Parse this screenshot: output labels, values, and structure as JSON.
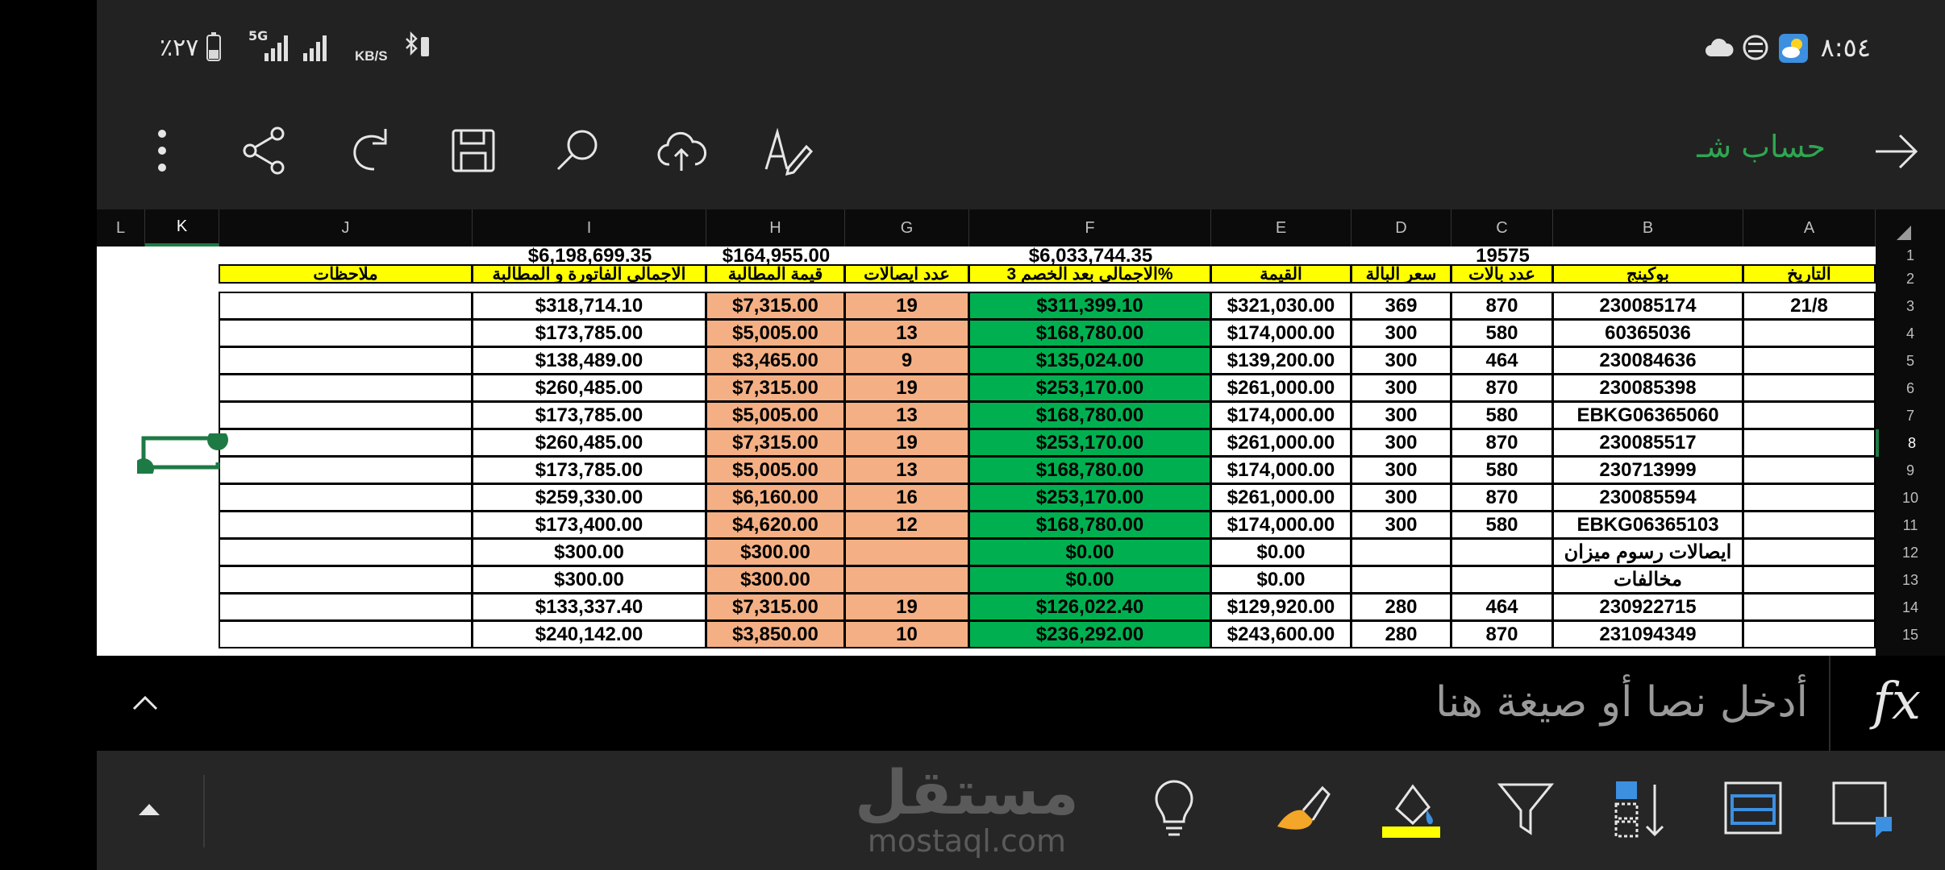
{
  "status_bar": {
    "time": "٨:٥٤",
    "battery": "٪٢٧",
    "network": "5G",
    "speed_unit": "KB/S"
  },
  "toolbar": {
    "sheet_name": "حساب شـ"
  },
  "columns": [
    "A",
    "B",
    "C",
    "D",
    "E",
    "F",
    "G",
    "H",
    "I",
    "J",
    "K",
    "L"
  ],
  "selected_column": "K",
  "rows": [
    "1",
    "2",
    "3",
    "4",
    "5",
    "6",
    "7",
    "8",
    "9",
    "10",
    "11",
    "12",
    "13",
    "14",
    "15"
  ],
  "selected_row": "8",
  "sheet": {
    "row1": {
      "C": "19575",
      "F": "$6,033,744.35",
      "H": "$164,955.00",
      "I": "$6,198,699.35"
    },
    "headers": {
      "A": "التاريخ",
      "B": "بوكينج",
      "C": "عدد بالات",
      "D": "سعر  البالة",
      "E": "القيمة",
      "F": "الاجمالى بعد الخصم 3%",
      "G": "عدد ايصالات",
      "H": "قيمة المطالبة",
      "I": "الاجمالى الفاتورة و المطالبة",
      "J": "ملاحظات"
    },
    "data": [
      {
        "A": "21/8",
        "B": "230085174",
        "C": "870",
        "D": "369",
        "E": "$321,030.00",
        "F": "$311,399.10",
        "G": "19",
        "H": "$7,315.00",
        "I": "$318,714.10",
        "J": ""
      },
      {
        "A": "",
        "B": "60365036",
        "C": "580",
        "D": "300",
        "E": "$174,000.00",
        "F": "$168,780.00",
        "G": "13",
        "H": "$5,005.00",
        "I": "$173,785.00",
        "J": ""
      },
      {
        "A": "",
        "B": "230084636",
        "C": "464",
        "D": "300",
        "E": "$139,200.00",
        "F": "$135,024.00",
        "G": "9",
        "H": "$3,465.00",
        "I": "$138,489.00",
        "J": ""
      },
      {
        "A": "",
        "B": "230085398",
        "C": "870",
        "D": "300",
        "E": "$261,000.00",
        "F": "$253,170.00",
        "G": "19",
        "H": "$7,315.00",
        "I": "$260,485.00",
        "J": ""
      },
      {
        "A": "",
        "B": "EBKG06365060",
        "C": "580",
        "D": "300",
        "E": "$174,000.00",
        "F": "$168,780.00",
        "G": "13",
        "H": "$5,005.00",
        "I": "$173,785.00",
        "J": ""
      },
      {
        "A": "",
        "B": "230085517",
        "C": "870",
        "D": "300",
        "E": "$261,000.00",
        "F": "$253,170.00",
        "G": "19",
        "H": "$7,315.00",
        "I": "$260,485.00",
        "J": ""
      },
      {
        "A": "",
        "B": "230713999",
        "C": "580",
        "D": "300",
        "E": "$174,000.00",
        "F": "$168,780.00",
        "G": "13",
        "H": "$5,005.00",
        "I": "$173,785.00",
        "J": ""
      },
      {
        "A": "",
        "B": "230085594",
        "C": "870",
        "D": "300",
        "E": "$261,000.00",
        "F": "$253,170.00",
        "G": "16",
        "H": "$6,160.00",
        "I": "$259,330.00",
        "J": ""
      },
      {
        "A": "",
        "B": "EBKG06365103",
        "C": "580",
        "D": "300",
        "E": "$174,000.00",
        "F": "$168,780.00",
        "G": "12",
        "H": "$4,620.00",
        "I": "$173,400.00",
        "J": ""
      },
      {
        "A": "",
        "B": "ايصالات رسوم ميزان",
        "C": "",
        "D": "",
        "E": "$0.00",
        "F": "$0.00",
        "G": "",
        "H": "$300.00",
        "I": "$300.00",
        "J": ""
      },
      {
        "A": "",
        "B": "مخالفات",
        "C": "",
        "D": "",
        "E": "$0.00",
        "F": "$0.00",
        "G": "",
        "H": "$300.00",
        "I": "$300.00",
        "J": ""
      },
      {
        "A": "",
        "B": "230922715",
        "C": "464",
        "D": "280",
        "E": "$129,920.00",
        "F": "$126,022.40",
        "G": "19",
        "H": "$7,315.00",
        "I": "$133,337.40",
        "J": ""
      },
      {
        "A": "",
        "B": "231094349",
        "C": "870",
        "D": "280",
        "E": "$243,600.00",
        "F": "$236,292.00",
        "G": "10",
        "H": "$3,850.00",
        "I": "$240,142.00",
        "J": ""
      }
    ]
  },
  "formula_bar": {
    "placeholder": "أدخل نصا أو صيغة هنا",
    "fx_label": "fx"
  },
  "watermark": {
    "arabic": "مستقل",
    "latin": "mostaql.com"
  },
  "colors": {
    "accent_green": "#2fa651",
    "header_yellow": "#ffff00",
    "orange_fill": "#f4b084",
    "green_fill": "#00b050"
  }
}
